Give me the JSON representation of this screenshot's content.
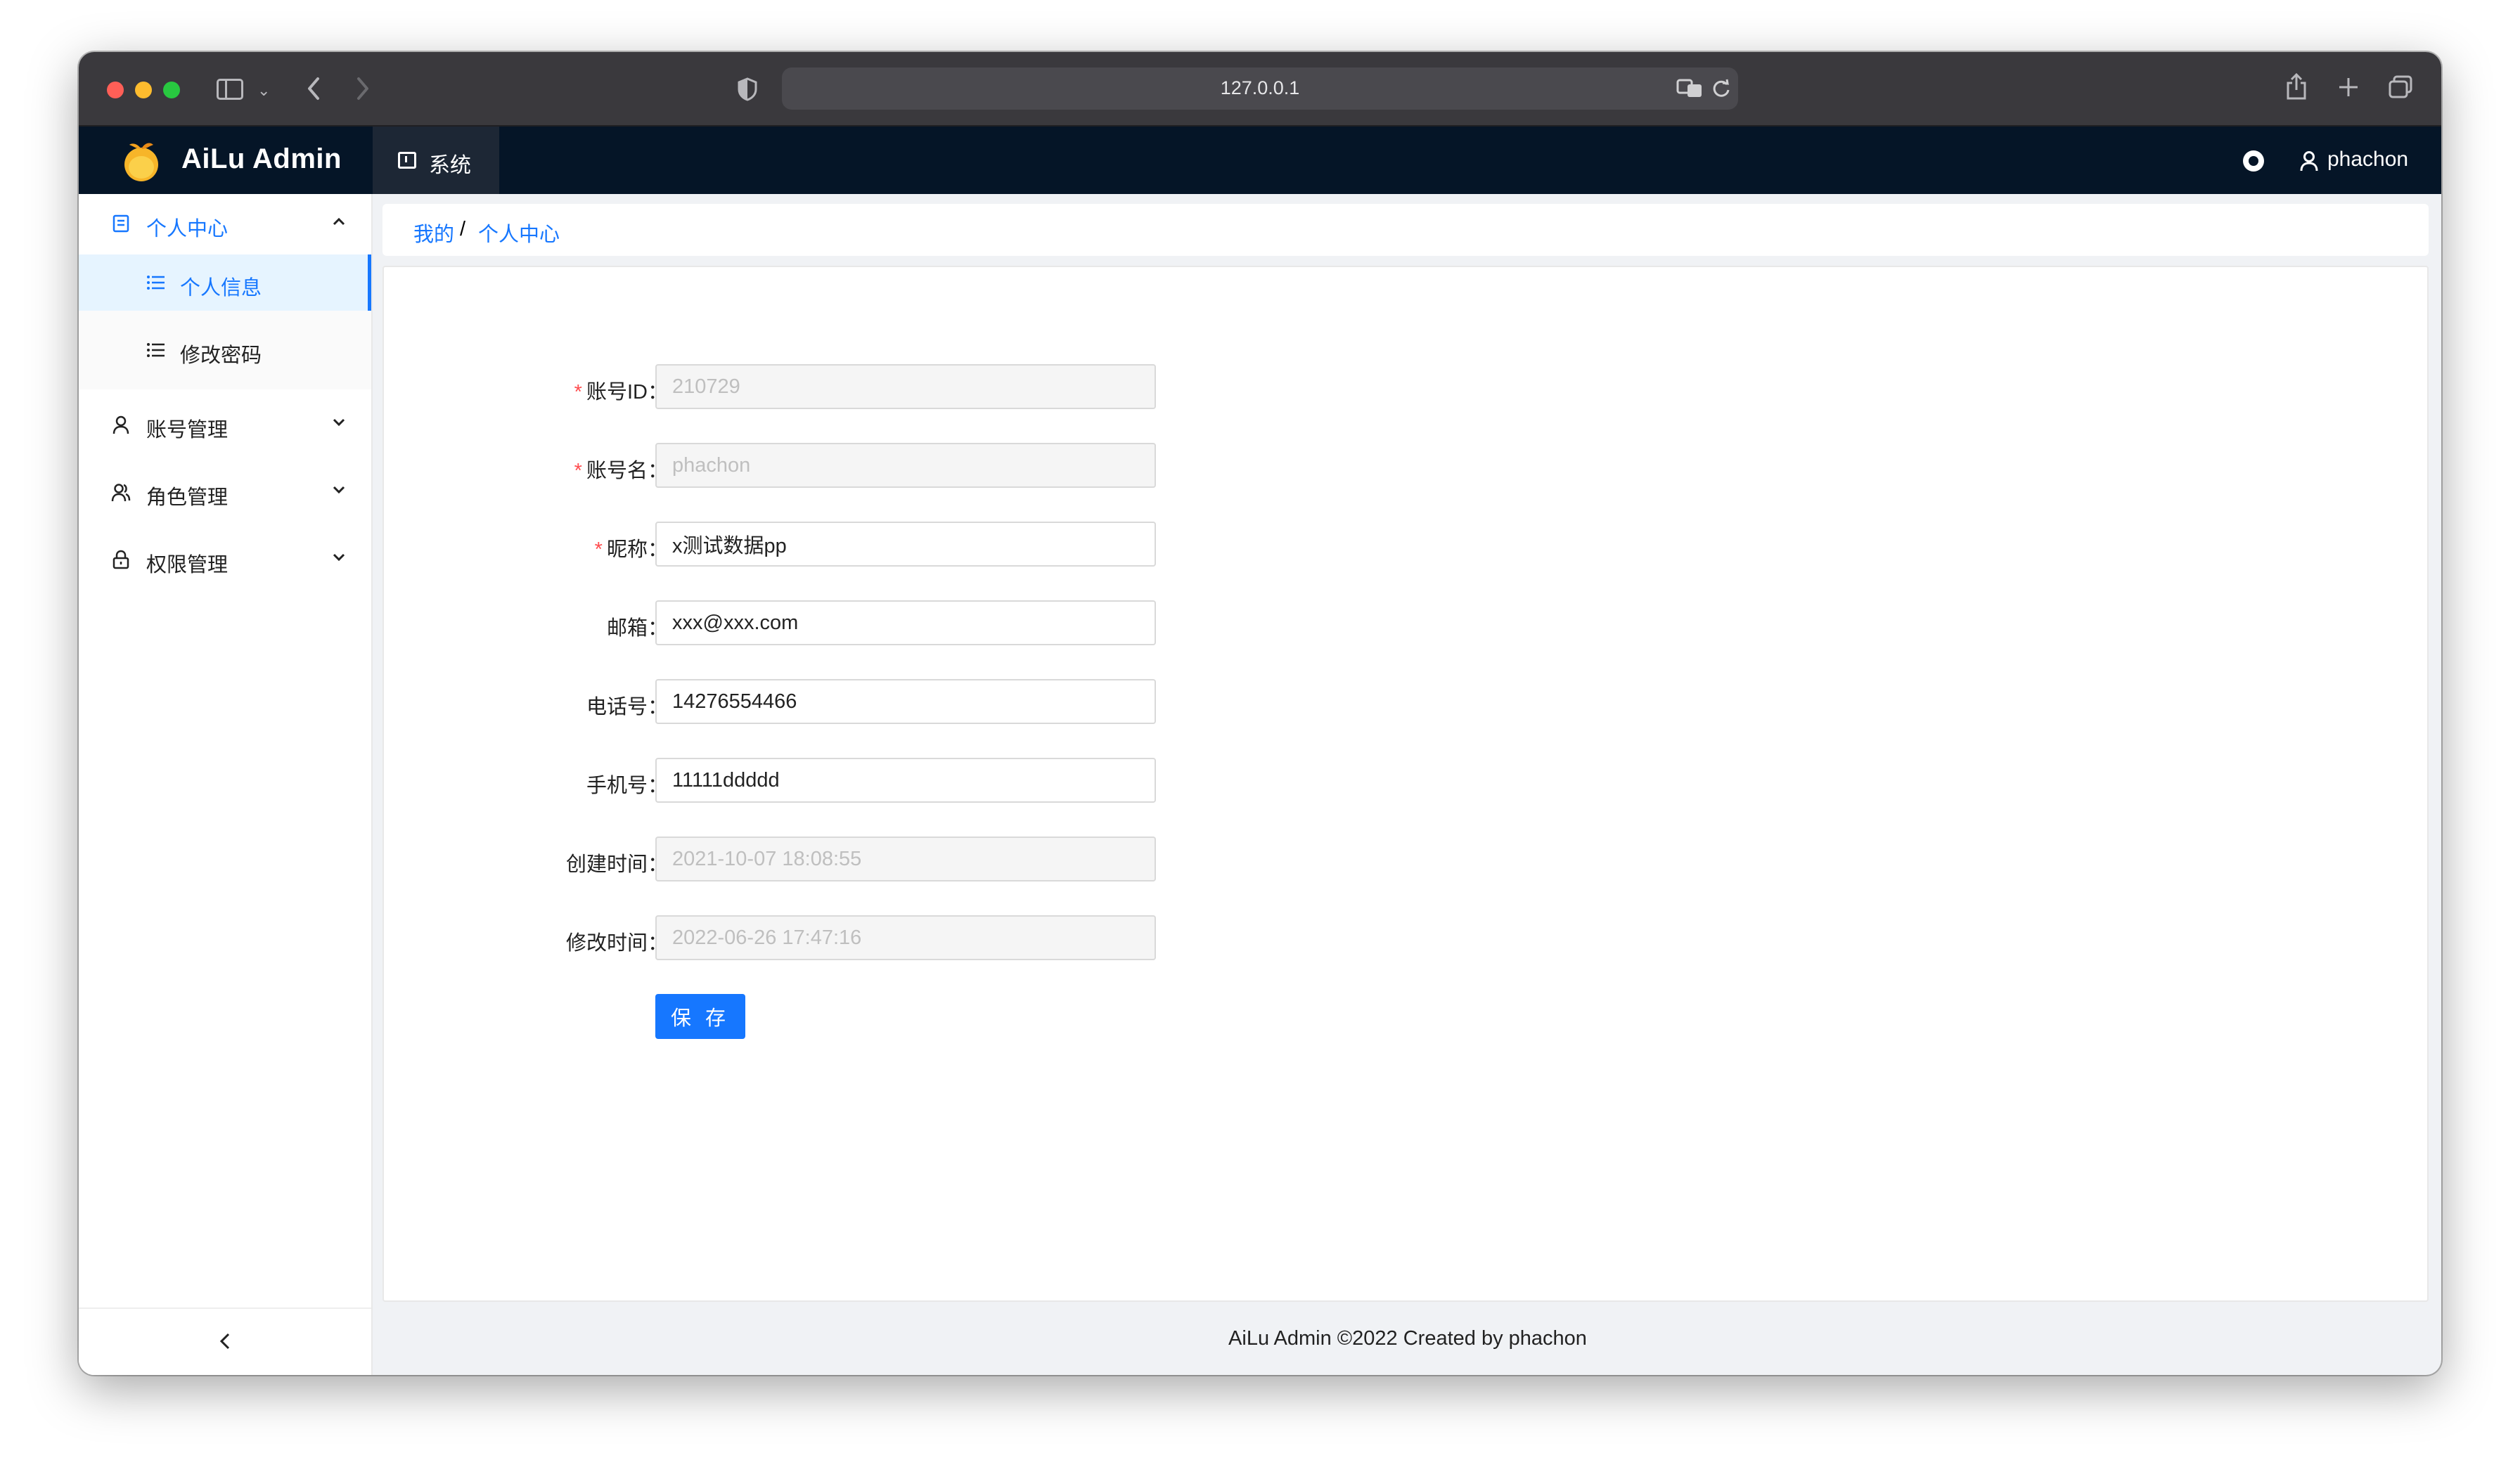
{
  "browser": {
    "url": "127.0.0.1"
  },
  "app": {
    "title": "AiLu Admin"
  },
  "top_nav": {
    "active_tab": "系统",
    "user_name": "phachon"
  },
  "sidebar": {
    "groups": [
      {
        "label": "个人中心",
        "expanded": true,
        "children": [
          {
            "label": "个人信息",
            "active": true
          },
          {
            "label": "修改密码",
            "active": false
          }
        ]
      },
      {
        "label": "账号管理",
        "expanded": false
      },
      {
        "label": "角色管理",
        "expanded": false
      },
      {
        "label": "权限管理",
        "expanded": false
      }
    ]
  },
  "breadcrumb": {
    "items": [
      "我的",
      "个人中心"
    ],
    "separator": "/"
  },
  "form": {
    "fields": [
      {
        "label": "账号ID",
        "required": true,
        "value": "210729",
        "disabled": true
      },
      {
        "label": "账号名",
        "required": true,
        "value": "phachon",
        "disabled": true
      },
      {
        "label": "昵称",
        "required": true,
        "value": "x测试数据pp",
        "disabled": false
      },
      {
        "label": "邮箱",
        "required": false,
        "value": "xxx@xxx.com",
        "disabled": false
      },
      {
        "label": "电话号",
        "required": false,
        "value": "14276554466",
        "disabled": false
      },
      {
        "label": "手机号",
        "required": false,
        "value": "11111ddddd",
        "disabled": false
      },
      {
        "label": "创建时间",
        "required": false,
        "value": "2021-10-07 18:08:55",
        "disabled": true
      },
      {
        "label": "修改时间",
        "required": false,
        "value": "2022-06-26 17:47:16",
        "disabled": true
      }
    ],
    "colon": "：",
    "required_mark": "*",
    "save_label": "保 存"
  },
  "footer": {
    "text": "AiLu Admin ©2022 Created by phachon"
  },
  "colors": {
    "primary": "#1677ff",
    "header_bg": "#051527",
    "required": "#ff4d4f"
  }
}
